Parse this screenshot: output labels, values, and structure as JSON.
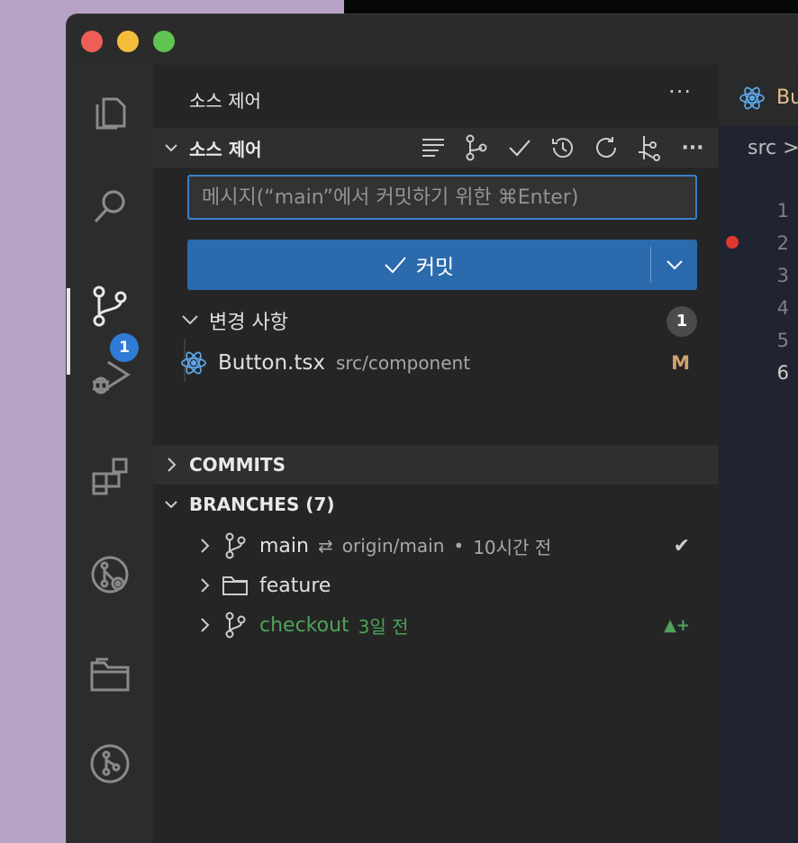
{
  "sidebar": {
    "title": "소스 제어",
    "more_label": "···"
  },
  "activity_bar": {
    "scm_badge": "1",
    "icons": [
      "explorer-icon",
      "search-icon",
      "source-control-icon",
      "run-debug-icon",
      "extensions-icon",
      "remote-explorer-icon",
      "folder-icon",
      "git-graph-icon"
    ]
  },
  "scm": {
    "section_title": "소스 제어",
    "more_label": "···",
    "message_placeholder": "메시지(“main”에서 커밋하기 위한 ⌘Enter)",
    "commit_label": "커밋",
    "changes": {
      "label": "변경 사항",
      "count": "1",
      "files": [
        {
          "name": "Button.tsx",
          "dir": "src/component",
          "status": "M"
        }
      ]
    }
  },
  "commits": {
    "title": "COMMITS"
  },
  "branches": {
    "title": "BRANCHES (7)",
    "items": [
      {
        "name": "main",
        "upstream": "origin/main",
        "sep": "•",
        "time": "10시간 전",
        "status": "✔"
      },
      {
        "name": "feature"
      },
      {
        "name": "checkout",
        "time": "3일 전",
        "status": "▲+"
      }
    ]
  },
  "editor": {
    "tab_label": "Bu",
    "breadcrumb": "src >",
    "line_numbers": [
      "1",
      "2",
      "3",
      "4",
      "5",
      "6"
    ]
  },
  "colors": {
    "accent": "#2b6aad",
    "input_border": "#3a80c8",
    "modified": "#d1a26d",
    "branch_green": "#4fa25a",
    "breakpoint": "#e0382f",
    "react_blue": "#5aa7e8"
  }
}
